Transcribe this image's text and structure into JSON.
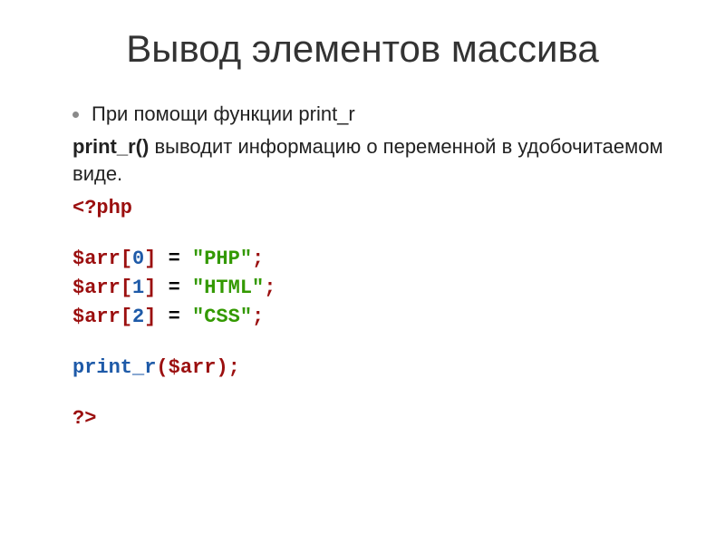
{
  "title": "Вывод элементов массива",
  "bullet": "При помощи функции print_r",
  "desc_bold": "print_r()",
  "desc_rest": " выводит информацию о переменной в удобочитаемом виде.",
  "code": {
    "open_tag": "<?php",
    "line1_var": "$arr",
    "line1_idx": "0",
    "line1_assign": " = ",
    "line1_val": "\"PHP\"",
    "line2_var": "$arr",
    "line2_idx": "1",
    "line2_assign": " = ",
    "line2_val": "\"HTML\"",
    "line3_var": "$arr",
    "line3_idx": "2",
    "line3_assign": " = ",
    "line3_val": "\"CSS\"",
    "call_fn": "print_r",
    "call_arg": "$arr",
    "close_tag": "?>"
  },
  "brackets": {
    "open": "[",
    "close": "]",
    "paren_open": "(",
    "paren_close": ")",
    "semi": ";"
  }
}
